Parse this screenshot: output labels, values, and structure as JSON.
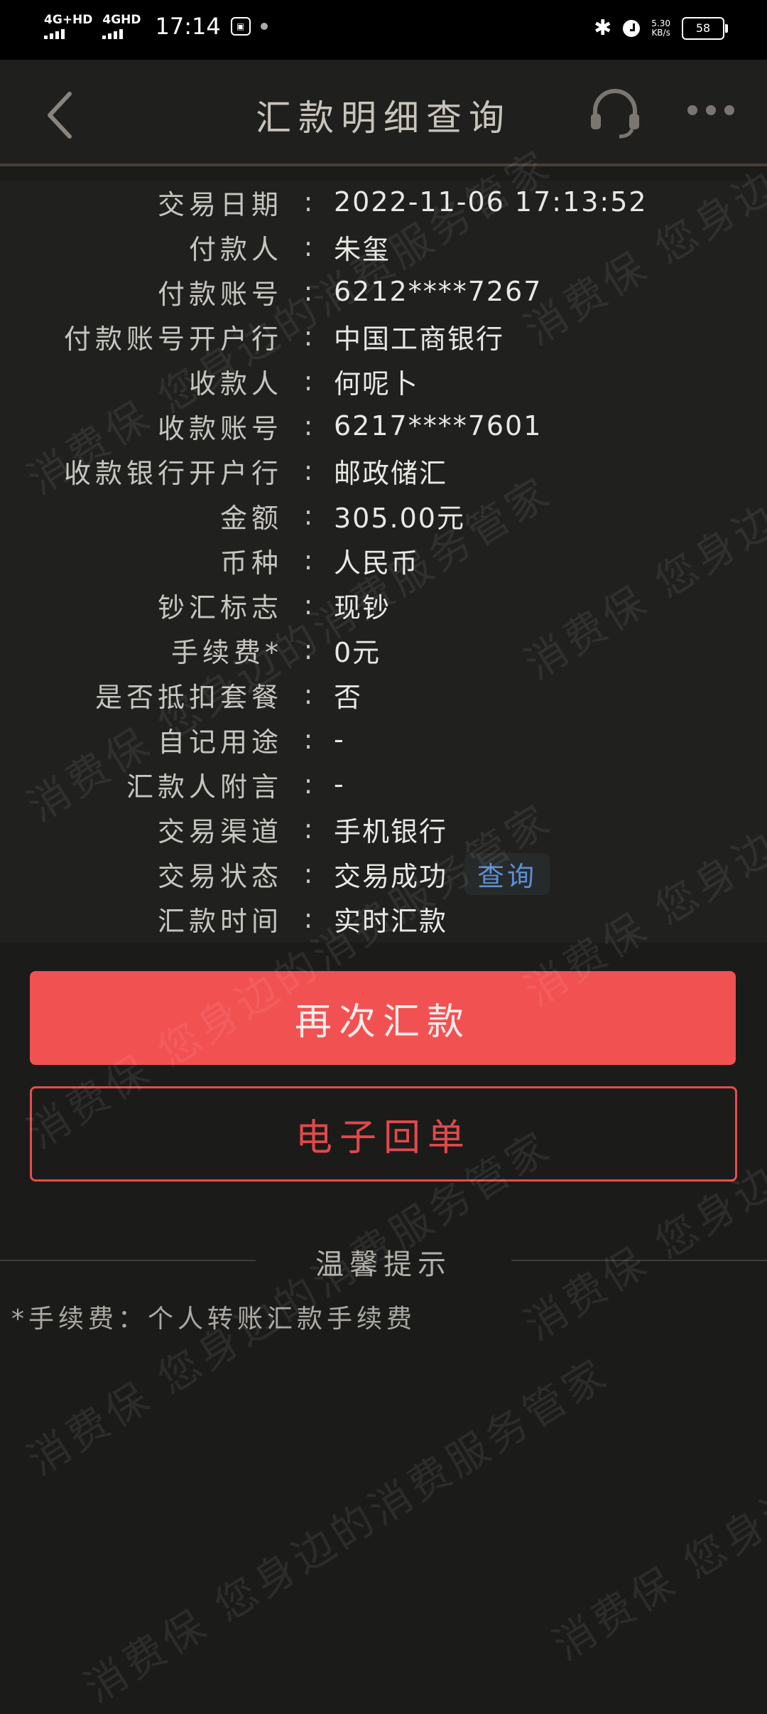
{
  "status_bar": {
    "network1": "4G+HD",
    "network2": "4GHD",
    "time": "17:14",
    "speed_value": "5.30",
    "speed_unit": "KB/s",
    "battery": "58"
  },
  "header": {
    "title": "汇款明细查询",
    "back_icon": "chevron-left-icon",
    "service_icon": "headset-icon",
    "more_icon": "more-dots-icon"
  },
  "details": [
    {
      "label": "交易日期",
      "value": "2022-11-06 17:13:52"
    },
    {
      "label": "付款人",
      "value": "朱玺"
    },
    {
      "label": "付款账号",
      "value": "6212****7267"
    },
    {
      "label": "付款账号开户行",
      "value": "中国工商银行"
    },
    {
      "label": "收款人",
      "value": "何呢卜"
    },
    {
      "label": "收款账号",
      "value": "6217****7601"
    },
    {
      "label": "收款银行开户行",
      "value": "邮政储汇"
    },
    {
      "label": "金额",
      "value": "305.00元"
    },
    {
      "label": "币种",
      "value": "人民币"
    },
    {
      "label": "钞汇标志",
      "value": "现钞"
    },
    {
      "label": "手续费*",
      "value": "0元"
    },
    {
      "label": "是否抵扣套餐",
      "value": "否"
    },
    {
      "label": "自记用途",
      "value": "-"
    },
    {
      "label": "汇款人附言",
      "value": "-"
    },
    {
      "label": "交易渠道",
      "value": "手机银行"
    },
    {
      "label": "交易状态",
      "value": "交易成功",
      "action": "查询"
    },
    {
      "label": "汇款时间",
      "value": "实时汇款"
    }
  ],
  "separator": ":",
  "buttons": {
    "remit_again": "再次汇款",
    "receipt": "电子回单"
  },
  "tips": {
    "title": "温馨提示",
    "text": "*手续费：个人转账汇款手续费"
  },
  "watermark": {
    "text1": "消费保 您身边的消费服务管家",
    "text2": "消费保 您身边"
  },
  "colors": {
    "primary": "#f25152",
    "link": "#5b8fd4",
    "background": "#1b1c1a"
  }
}
